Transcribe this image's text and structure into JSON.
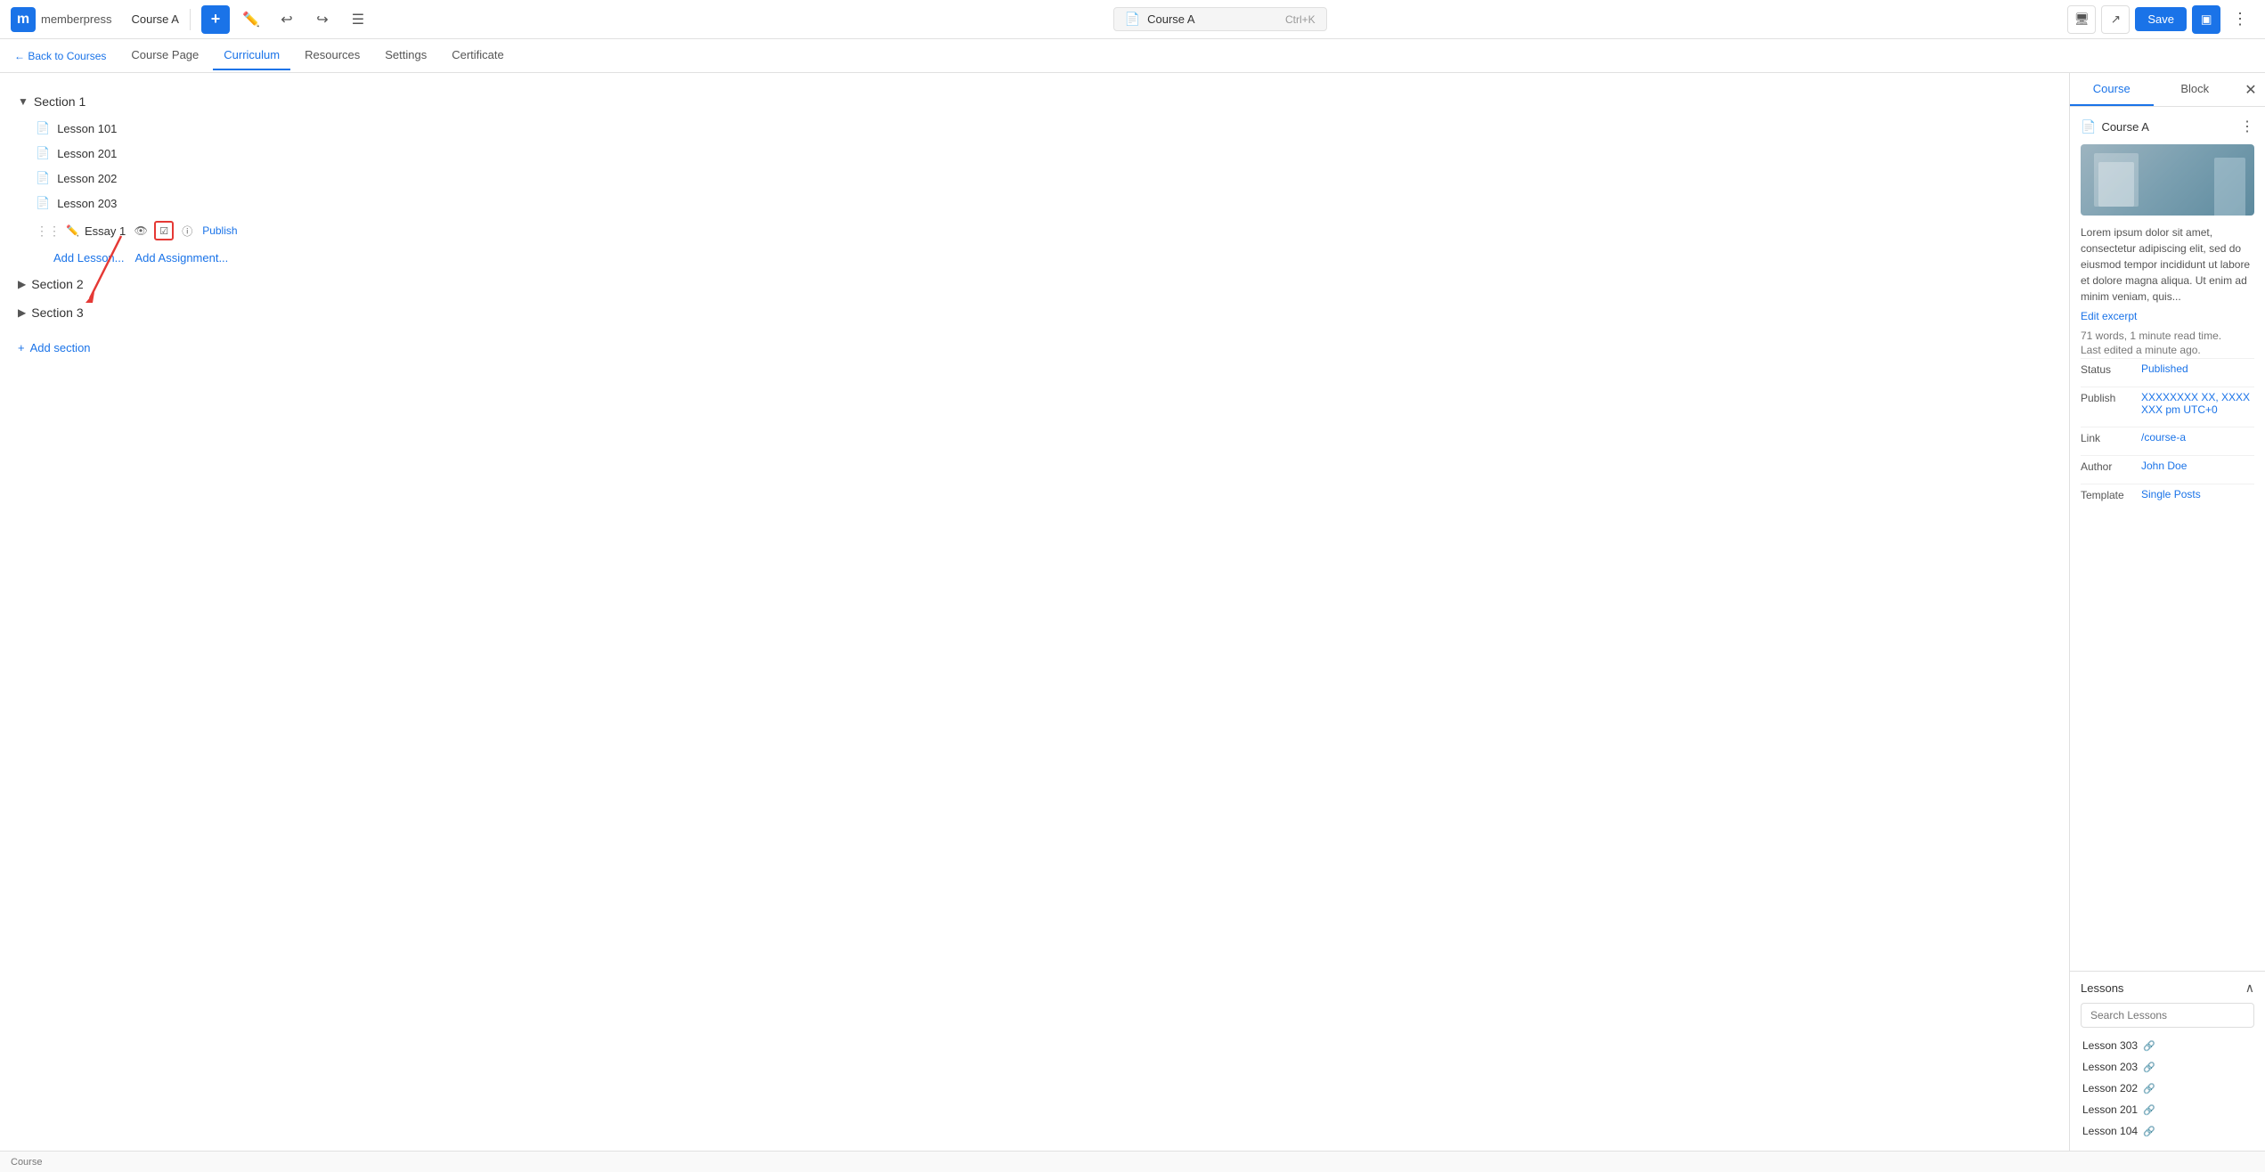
{
  "app": {
    "logo_letter": "m",
    "brand": "memberpress",
    "course_title": "Course A"
  },
  "toolbar": {
    "save_label": "Save",
    "course_name": "Course A",
    "shortcut": "Ctrl+K"
  },
  "nav": {
    "back_label": "← Back to Courses",
    "tabs": [
      {
        "id": "course-page",
        "label": "Course Page",
        "active": false
      },
      {
        "id": "curriculum",
        "label": "Curriculum",
        "active": true
      },
      {
        "id": "resources",
        "label": "Resources",
        "active": false
      },
      {
        "id": "settings",
        "label": "Settings",
        "active": false
      },
      {
        "id": "certificate",
        "label": "Certificate",
        "active": false
      }
    ]
  },
  "curriculum": {
    "sections": [
      {
        "id": "section-1",
        "label": "Section 1",
        "expanded": true,
        "lessons": [
          {
            "id": "lesson-101",
            "label": "Lesson 101"
          },
          {
            "id": "lesson-201",
            "label": "Lesson 201"
          },
          {
            "id": "lesson-202",
            "label": "Lesson 202"
          },
          {
            "id": "lesson-203",
            "label": "Lesson 203"
          }
        ],
        "essays": [
          {
            "id": "essay-1",
            "label": "Essay 1",
            "publish_label": "Publish"
          }
        ],
        "add_lesson_label": "Add Lesson...",
        "add_assignment_label": "Add Assignment..."
      },
      {
        "id": "section-2",
        "label": "Section 2",
        "expanded": false
      },
      {
        "id": "section-3",
        "label": "Section 3",
        "expanded": false
      }
    ],
    "add_section_label": "Add section"
  },
  "right_panel": {
    "tabs": [
      {
        "id": "course-tab",
        "label": "Course",
        "active": true
      },
      {
        "id": "block-tab",
        "label": "Block",
        "active": false
      }
    ],
    "course": {
      "name": "Course A",
      "excerpt": "Lorem ipsum dolor sit amet, consectetur adipiscing elit, sed do eiusmod tempor incididunt ut labore et dolore magna aliqua. Ut enim ad minim veniam, quis...",
      "edit_excerpt_label": "Edit excerpt",
      "word_count": "71 words, 1 minute read time.",
      "last_edited": "Last edited a minute ago.",
      "status_label": "Status",
      "status_value": "Published",
      "publish_label": "Publish",
      "publish_value": "XXXXXXXX XX, XXXX XXX pm UTC+0",
      "link_label": "Link",
      "link_value": "/course-a",
      "author_label": "Author",
      "author_value": "John Doe",
      "template_label": "Template",
      "template_value": "Single Posts"
    },
    "lessons_section": {
      "title": "Lessons",
      "search_placeholder": "Search Lessons",
      "items": [
        {
          "id": "lesson-303",
          "label": "Lesson 303"
        },
        {
          "id": "lesson-203",
          "label": "Lesson 203"
        },
        {
          "id": "lesson-202",
          "label": "Lesson 202"
        },
        {
          "id": "lesson-201",
          "label": "Lesson 201"
        },
        {
          "id": "lesson-104",
          "label": "Lesson 104"
        }
      ]
    }
  },
  "status_bar": {
    "text": "Course"
  }
}
